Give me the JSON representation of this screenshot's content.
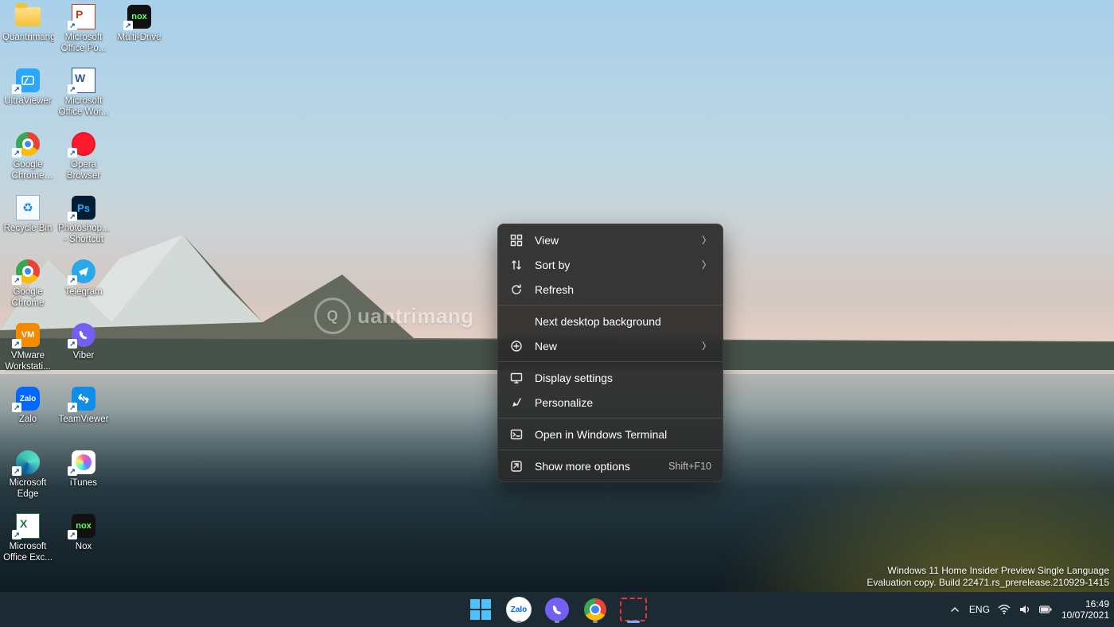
{
  "desktop_icons": [
    {
      "id": "quantrimang",
      "label": "Quantrimang",
      "kind": "folder",
      "shortcut": false
    },
    {
      "id": "ms-ppt",
      "label": "Microsoft Office Po...",
      "kind": "ppt",
      "shortcut": true
    },
    {
      "id": "multi-drive",
      "label": "Multi-Drive",
      "kind": "nox",
      "shortcut": true
    },
    {
      "id": "ultraviewer",
      "label": "UltraViewer",
      "kind": "uv",
      "shortcut": true
    },
    {
      "id": "ms-word",
      "label": "Microsoft Office Wor...",
      "kind": "word",
      "shortcut": true
    },
    {
      "id": "chrome-dev",
      "label": "Google Chrome Dev",
      "kind": "chromedev",
      "shortcut": true
    },
    {
      "id": "opera",
      "label": "Opera Browser",
      "kind": "opera",
      "shortcut": true
    },
    {
      "id": "recycle-bin",
      "label": "Recycle Bin",
      "kind": "bin",
      "shortcut": false
    },
    {
      "id": "photoshop",
      "label": "Photoshop... - Shortcut",
      "kind": "ps",
      "shortcut": true
    },
    {
      "id": "chrome",
      "label": "Google Chrome",
      "kind": "chrome",
      "shortcut": true
    },
    {
      "id": "telegram",
      "label": "Telegram",
      "kind": "tg",
      "shortcut": true
    },
    {
      "id": "vmware",
      "label": "VMware Workstati...",
      "kind": "vmw",
      "shortcut": true
    },
    {
      "id": "viber",
      "label": "Viber",
      "kind": "viber",
      "shortcut": true
    },
    {
      "id": "zalo",
      "label": "Zalo",
      "kind": "zalo",
      "shortcut": true
    },
    {
      "id": "teamviewer",
      "label": "TeamViewer",
      "kind": "tv",
      "shortcut": true
    },
    {
      "id": "edge",
      "label": "Microsoft Edge",
      "kind": "edge",
      "shortcut": true
    },
    {
      "id": "itunes",
      "label": "iTunes",
      "kind": "itunes",
      "shortcut": true
    },
    {
      "id": "ms-excel",
      "label": "Microsoft Office Exc...",
      "kind": "excel",
      "shortcut": true
    },
    {
      "id": "nox",
      "label": "Nox",
      "kind": "nox",
      "shortcut": true
    }
  ],
  "context_menu": {
    "items": [
      {
        "id": "view",
        "label": "View",
        "icon": "view",
        "submenu": true
      },
      {
        "id": "sort",
        "label": "Sort by",
        "icon": "sort",
        "submenu": true
      },
      {
        "id": "refresh",
        "label": "Refresh",
        "icon": "refresh"
      },
      {
        "sep": true
      },
      {
        "id": "next-bg",
        "label": "Next desktop background",
        "icon": ""
      },
      {
        "id": "new",
        "label": "New",
        "icon": "new",
        "submenu": true
      },
      {
        "sep": true
      },
      {
        "id": "display",
        "label": "Display settings",
        "icon": "display"
      },
      {
        "id": "personalize",
        "label": "Personalize",
        "icon": "personalize"
      },
      {
        "sep": true
      },
      {
        "id": "terminal",
        "label": "Open in Windows Terminal",
        "icon": "terminal"
      },
      {
        "sep": true
      },
      {
        "id": "more",
        "label": "Show more options",
        "icon": "more",
        "accel": "Shift+F10"
      }
    ]
  },
  "watermark": {
    "line1": "Windows 11 Home Insider Preview Single Language",
    "line2": "Evaluation copy. Build 22471.rs_prerelease.210929-1415"
  },
  "center_watermark": "uantrimang",
  "taskbar": {
    "pinned": [
      {
        "id": "start",
        "name": "start-button"
      },
      {
        "id": "zalo",
        "name": "taskbar-zalo",
        "running": true
      },
      {
        "id": "viber",
        "name": "taskbar-viber",
        "running": true
      },
      {
        "id": "chrome",
        "name": "taskbar-chrome",
        "running": true
      },
      {
        "id": "snip",
        "name": "taskbar-snipping-tool",
        "active": true
      }
    ],
    "tray": {
      "lang": "ENG",
      "time": "16:49",
      "date": "10/07/2021"
    }
  }
}
